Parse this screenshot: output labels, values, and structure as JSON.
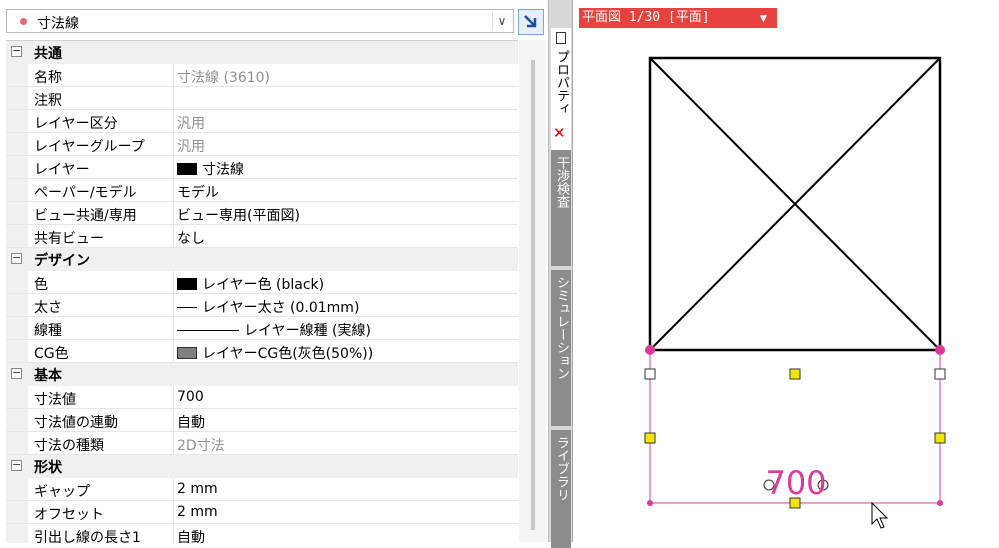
{
  "combo": {
    "selected": "寸法線",
    "arrow": "∨"
  },
  "categories": {
    "common": {
      "label": "共通",
      "toggle": "⊟"
    },
    "design": {
      "label": "デザイン",
      "toggle": "⊟"
    },
    "basic": {
      "label": "基本",
      "toggle": "⊟"
    },
    "shape": {
      "label": "形状",
      "toggle": "⊟"
    }
  },
  "props": {
    "name": {
      "label": "名称",
      "value": "寸法線 (3610)"
    },
    "note": {
      "label": "注釈",
      "value": ""
    },
    "layer_div": {
      "label": "レイヤー区分",
      "value": "汎用"
    },
    "layer_group": {
      "label": "レイヤーグループ",
      "value": "汎用"
    },
    "layer": {
      "label": "レイヤー",
      "value": "寸法線"
    },
    "paper_model": {
      "label": "ペーパー/モデル",
      "value": "モデル"
    },
    "view_common": {
      "label": "ビュー共通/専用",
      "value": "ビュー専用(平面図)"
    },
    "shared_view": {
      "label": "共有ビュー",
      "value": "なし"
    },
    "color": {
      "label": "色",
      "value": "レイヤー色 (black)"
    },
    "weight": {
      "label": "太さ",
      "value": "レイヤー太さ (0.01mm)"
    },
    "linetype": {
      "label": "線種",
      "value": "レイヤー線種 (実線)"
    },
    "cg_color": {
      "label": "CG色",
      "value": "レイヤーCG色(灰色(50%))"
    },
    "dim_value": {
      "label": "寸法値",
      "value": "700"
    },
    "dim_link": {
      "label": "寸法値の連動",
      "value": "自動"
    },
    "dim_type": {
      "label": "寸法の種類",
      "value": "2D寸法"
    },
    "gap": {
      "label": "ギャップ",
      "value": "2 mm"
    },
    "offset": {
      "label": "オフセット",
      "value": "2 mm"
    },
    "leader_len": {
      "label": "引出し線の長さ1",
      "value": "自動"
    }
  },
  "tabs": {
    "properties": "プロパティ",
    "interference": "干渉検査",
    "simulation": "シミュレーション",
    "library": "ライブラリ",
    "close": "✕"
  },
  "view": {
    "tab_label": "平面図 1/30 [平面]",
    "dropdown": "▼",
    "dimension_text": "700"
  },
  "colors": {
    "accent": "#e8413e",
    "magenta": "#e0389a",
    "handle_yellow": "#f2e600"
  }
}
